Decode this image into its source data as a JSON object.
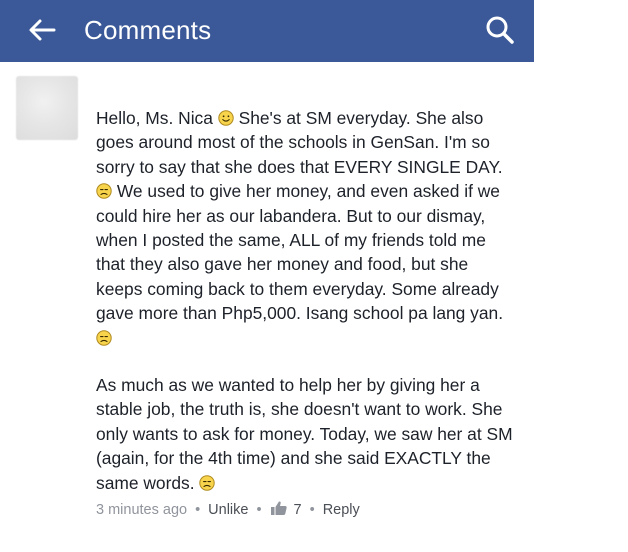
{
  "header": {
    "title": "Comments",
    "back_icon": "back-arrow-icon",
    "search_icon": "search-icon",
    "bar_color": "#3b5998"
  },
  "comment": {
    "p1": {
      "t1": "Hello, Ms. Nica ",
      "t2": " She's at SM everyday. She also goes around most of the schools in GenSan. I'm so sorry to say that she does that EVERY SINGLE DAY. ",
      "t3": " We used to give her money, and even asked if we could hire her as our labandera. But to our dismay, when I posted the same, ALL of my friends told me that they also gave her money and food, but she keeps coming back to them everyday. Some already gave more than Php5,000. Isang school pa lang yan. "
    },
    "p2": {
      "t1": "As much as we wanted to help her by giving her a stable job, the truth is, she doesn't want to work. She only wants to ask for money. Today, we saw her at SM (again, for the 4th time) and she said EXACTLY the same words. "
    },
    "emoji_smile": "smile-emoji-icon",
    "emoji_sad": "sad-emoji-icon"
  },
  "meta": {
    "time": "3 minutes ago",
    "sep": "•",
    "like_label": "Unlike",
    "like_count": "7",
    "reply_label": "Reply",
    "thumb_icon": "thumbs-up-icon"
  }
}
